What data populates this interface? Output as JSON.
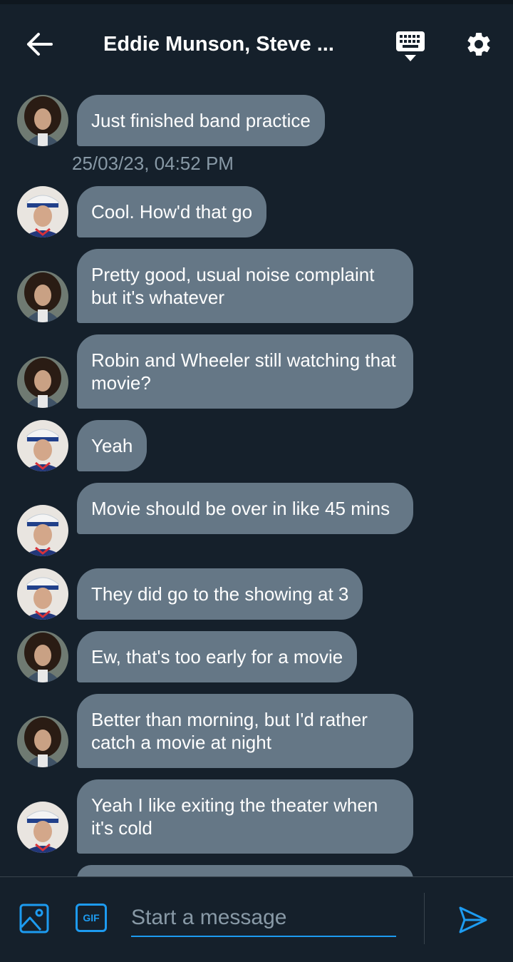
{
  "header": {
    "title": "Eddie Munson, Steve ...",
    "back_icon": "arrow-left-icon",
    "keyboard_icon": "keyboard-icon",
    "settings_icon": "gear-icon"
  },
  "participants": {
    "eddie": {
      "avatar_icon": "avatar-eddie"
    },
    "steve": {
      "avatar_icon": "avatar-steve"
    }
  },
  "messages": [
    {
      "sender": "eddie",
      "text": "Just finished band practice"
    },
    {
      "timestamp": "25/03/23, 04:52 PM"
    },
    {
      "sender": "steve",
      "text": "Cool. How'd that go"
    },
    {
      "sender": "eddie",
      "text": "Pretty good, usual noise complaint but it's whatever"
    },
    {
      "sender": "eddie",
      "text": "Robin and Wheeler still watching that movie?"
    },
    {
      "sender": "steve",
      "text": "Yeah"
    },
    {
      "sender": "steve",
      "text": "Movie should be over in like 45 mins"
    },
    {
      "sender": "steve",
      "text": "They did go to the showing at 3"
    },
    {
      "sender": "eddie",
      "text": "Ew, that's too early for a movie"
    },
    {
      "sender": "eddie",
      "text": "Better than morning, but I'd rather catch a movie at night"
    },
    {
      "sender": "steve",
      "text": "Yeah I like exiting the theater when it's cold"
    }
  ],
  "composer": {
    "image_icon": "image-icon",
    "gif_label": "GIF",
    "placeholder": "Start a message",
    "value": "",
    "send_icon": "send-icon"
  },
  "colors": {
    "background": "#15202b",
    "bubble": "#657786",
    "accent": "#1d9bf0",
    "muted_text": "#8899a6"
  }
}
